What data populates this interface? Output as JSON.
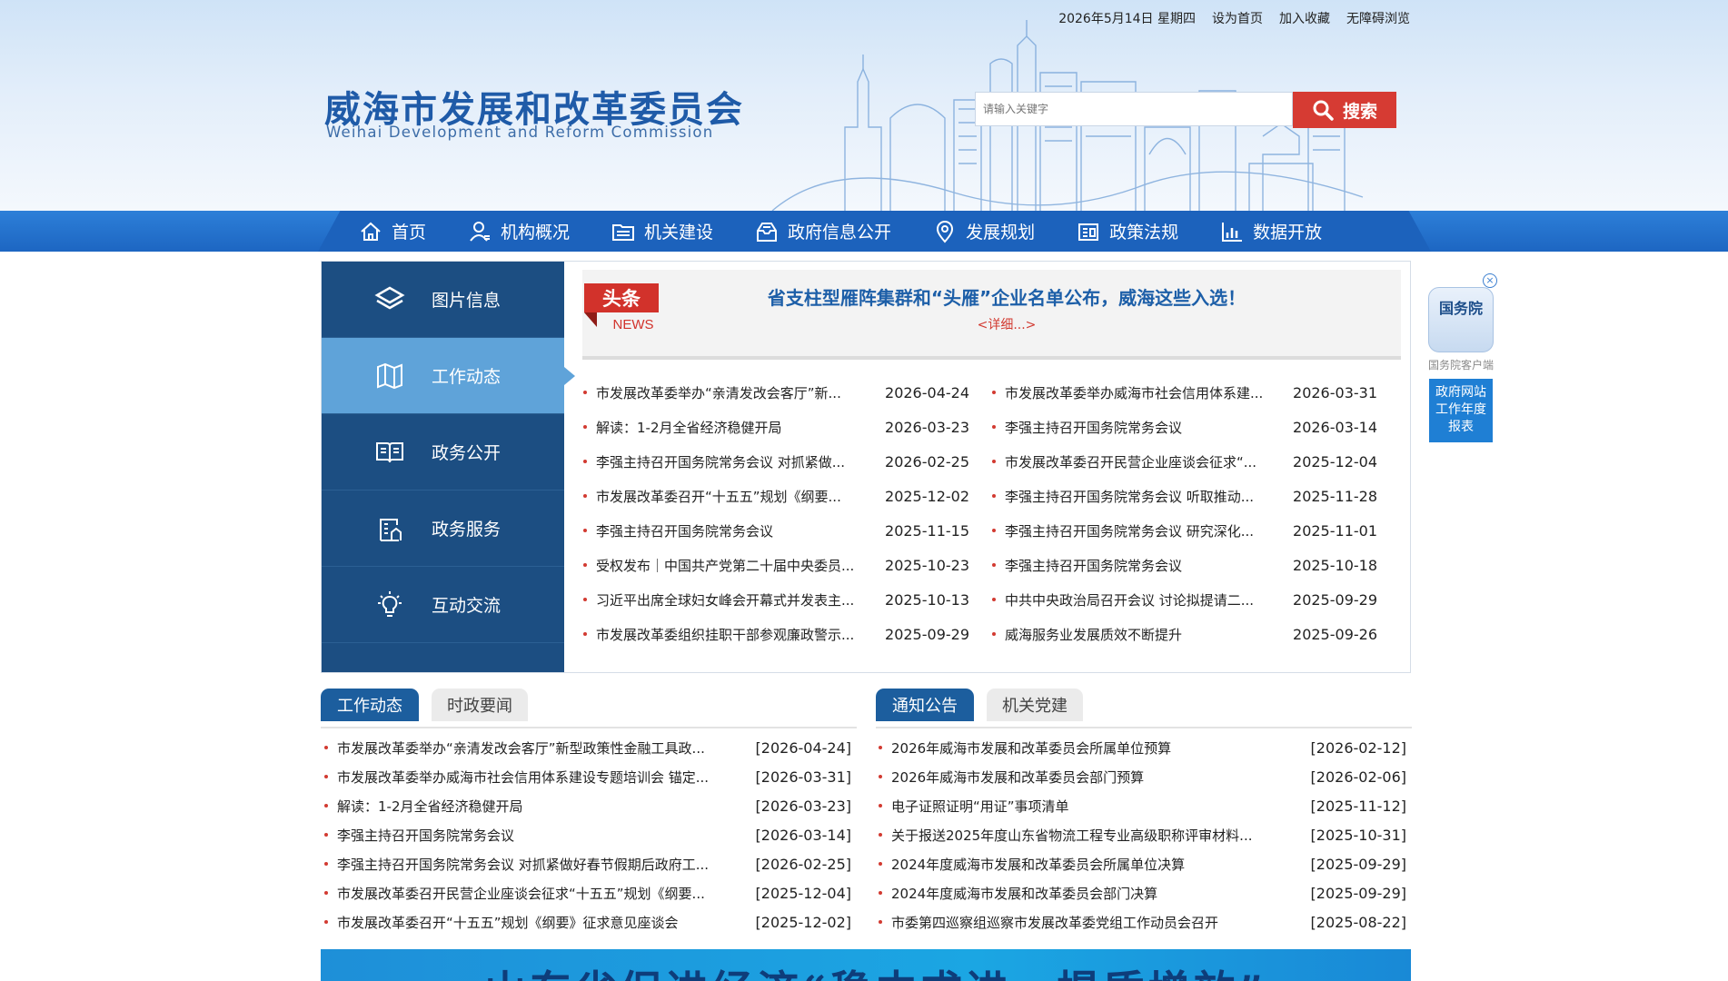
{
  "top_links": [
    "2026年5月14日 星期四",
    "设为首页",
    "加入收藏",
    "无障碍浏览"
  ],
  "site": {
    "title": "威海市发展和改革委员会",
    "subtitle": "Weihai Development and Reform Commission"
  },
  "search": {
    "placeholder": "请输入关键字",
    "button_label": "搜索"
  },
  "nav": [
    {
      "label": "首页",
      "icon": "home-icon"
    },
    {
      "label": "机构概况",
      "icon": "person-icon"
    },
    {
      "label": "机关建设",
      "icon": "folder-icon"
    },
    {
      "label": "政府信息公开",
      "icon": "inbox-icon"
    },
    {
      "label": "发展规划",
      "icon": "location-pin-icon"
    },
    {
      "label": "政策法规",
      "icon": "document-icon"
    },
    {
      "label": "数据开放",
      "icon": "bar-chart-icon"
    }
  ],
  "sidebar": [
    {
      "label": "图片信息",
      "icon": "layers-icon",
      "active": false
    },
    {
      "label": "工作动态",
      "icon": "map-book-icon",
      "active": true
    },
    {
      "label": "政务公开",
      "icon": "open-book-icon",
      "active": false
    },
    {
      "label": "政务服务",
      "icon": "building-icon",
      "active": false
    },
    {
      "label": "互动交流",
      "icon": "lightbulb-icon",
      "active": false
    }
  ],
  "headline": {
    "badge_cn": "头条",
    "badge_en": "NEWS",
    "title": "省支柱型雁阵集群和“头雁”企业名单公布，威海这些入选！",
    "more": "<详细...>"
  },
  "news_left": [
    {
      "title": "市发展改革委举办“亲清发改会客厅”新...",
      "date": "2026-04-24"
    },
    {
      "title": "解读：1-2月全省经济稳健开局",
      "date": "2026-03-23"
    },
    {
      "title": "李强主持召开国务院常务会议 对抓紧做...",
      "date": "2026-02-25"
    },
    {
      "title": "市发展改革委召开“十五五”规划《纲要...",
      "date": "2025-12-02"
    },
    {
      "title": "李强主持召开国务院常务会议",
      "date": "2025-11-15"
    },
    {
      "title": "受权发布｜中国共产党第二十届中央委员...",
      "date": "2025-10-23"
    },
    {
      "title": "习近平出席全球妇女峰会开幕式并发表主...",
      "date": "2025-10-13"
    },
    {
      "title": "市发展改革委组织挂职干部参观廉政警示...",
      "date": "2025-09-29"
    }
  ],
  "news_right": [
    {
      "title": "市发展改革委举办威海市社会信用体系建...",
      "date": "2026-03-31"
    },
    {
      "title": "李强主持召开国务院常务会议",
      "date": "2026-03-14"
    },
    {
      "title": "市发展改革委召开民营企业座谈会征求“...",
      "date": "2025-12-04"
    },
    {
      "title": "李强主持召开国务院常务会议 听取推动...",
      "date": "2025-11-28"
    },
    {
      "title": "李强主持召开国务院常务会议 研究深化...",
      "date": "2025-11-01"
    },
    {
      "title": "李强主持召开国务院常务会议",
      "date": "2025-10-18"
    },
    {
      "title": "中共中央政治局召开会议 讨论拟提请二...",
      "date": "2025-09-29"
    },
    {
      "title": "威海服务业发展质效不断提升",
      "date": "2025-09-26"
    }
  ],
  "float": {
    "close": "×",
    "app_name": "国务院",
    "caption": "国务院客户端",
    "report": "政府网站工作年度报表"
  },
  "left_tabs": [
    {
      "label": "工作动态",
      "active": true
    },
    {
      "label": "时政要闻",
      "active": false
    }
  ],
  "right_tabs": [
    {
      "label": "通知公告",
      "active": true
    },
    {
      "label": "机关党建",
      "active": false
    }
  ],
  "work_list": [
    {
      "title": "市发展改革委举办“亲清发改会客厅”新型政策性金融工具政...",
      "date": "[2026-04-24]"
    },
    {
      "title": "市发展改革委举办威海市社会信用体系建设专题培训会 锚定...",
      "date": "[2026-03-31]"
    },
    {
      "title": "解读：1-2月全省经济稳健开局",
      "date": "[2026-03-23]"
    },
    {
      "title": "李强主持召开国务院常务会议",
      "date": "[2026-03-14]"
    },
    {
      "title": "李强主持召开国务院常务会议 对抓紧做好春节假期后政府工...",
      "date": "[2026-02-25]"
    },
    {
      "title": "市发展改革委召开民营企业座谈会征求“十五五”规划《纲要...",
      "date": "[2025-12-04]"
    },
    {
      "title": "市发展改革委召开“十五五”规划《纲要》征求意见座谈会",
      "date": "[2025-12-02]"
    }
  ],
  "notice_list": [
    {
      "title": "2026年威海市发展和改革委员会所属单位预算",
      "date": "[2026-02-12]"
    },
    {
      "title": "2026年威海市发展和改革委员会部门预算",
      "date": "[2026-02-06]"
    },
    {
      "title": "电子证照证明“用证”事项清单",
      "date": "[2025-11-12]"
    },
    {
      "title": "关于报送2025年度山东省物流工程专业高级职称评审材料...",
      "date": "[2025-10-31]"
    },
    {
      "title": "2024年度威海市发展和改革委员会所属单位决算",
      "date": "[2025-09-29]"
    },
    {
      "title": "2024年度威海市发展和改革委员会部门决算",
      "date": "[2025-09-29]"
    },
    {
      "title": "市委第四巡察组巡察市发展改革委党组工作动员会召开",
      "date": "[2025-08-22]"
    }
  ],
  "banner": {
    "text": "山东省促进经济“稳中求进、提质增效”"
  },
  "colors": {
    "brand_blue": "#1c62bc",
    "sidebar": "#1c4e82",
    "accent_red": "#d63b33",
    "title_blue": "#1f5ba8"
  }
}
